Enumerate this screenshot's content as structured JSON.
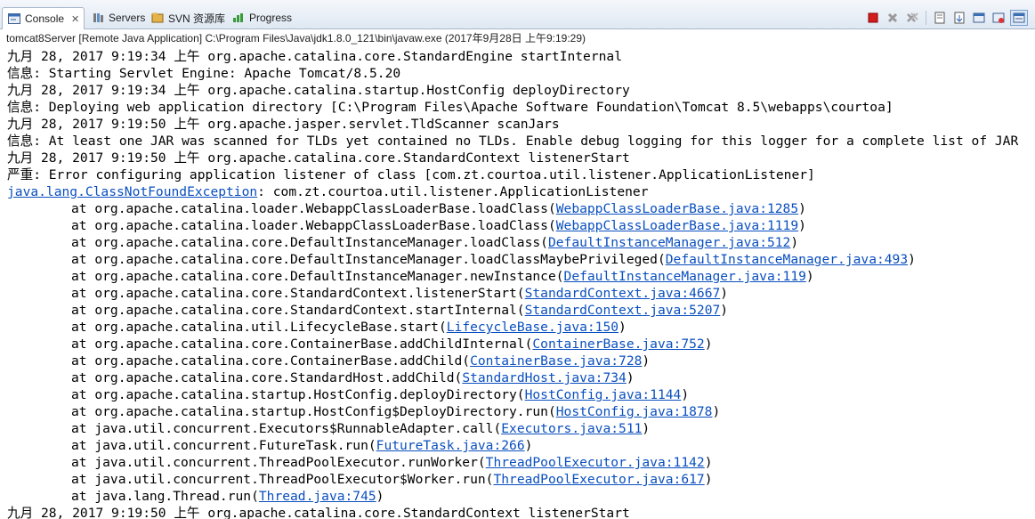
{
  "tabs": [
    {
      "label": "Console",
      "icon": "console-icon",
      "active": true
    },
    {
      "label": "Servers",
      "icon": "servers-icon"
    },
    {
      "label": "SVN 资源库",
      "icon": "svn-icon"
    },
    {
      "label": "Progress",
      "icon": "progress-icon"
    }
  ],
  "toolbar": [
    "terminate-icon",
    "remove-launch-icon",
    "remove-all-icon",
    "clear-console-icon",
    "scroll-lock-icon",
    "show-console-icon",
    "pin-console-icon",
    "display-selected-console-icon"
  ],
  "launch_info": "tomcat8Server [Remote Java Application] C:\\Program Files\\Java\\jdk1.8.0_121\\bin\\javaw.exe (2017年9月28日 上午9:19:29)",
  "log": {
    "l1": "九月 28, 2017 9:19:34 上午 org.apache.catalina.core.StandardEngine startInternal",
    "l2": "信息: Starting Servlet Engine: Apache Tomcat/8.5.20",
    "l3": "九月 28, 2017 9:19:34 上午 org.apache.catalina.startup.HostConfig deployDirectory",
    "l4": "信息: Deploying web application directory [C:\\Program Files\\Apache Software Foundation\\Tomcat 8.5\\webapps\\courtoa]",
    "l5": "九月 28, 2017 9:19:50 上午 org.apache.jasper.servlet.TldScanner scanJars",
    "l6": "信息: At least one JAR was scanned for TLDs yet contained no TLDs. Enable debug logging for this logger for a complete list of JAR",
    "l7": "九月 28, 2017 9:19:50 上午 org.apache.catalina.core.StandardContext listenerStart",
    "l8": "严重: Error configuring application listener of class [com.zt.courtoa.util.listener.ApplicationListener]",
    "exception_link": "java.lang.ClassNotFoundException",
    "exception_msg": ": com.zt.courtoa.util.listener.ApplicationListener",
    "last": "九月 28, 2017 9:19:50 上午 org.apache.catalina.core.StandardContext listenerStart"
  },
  "stack": [
    {
      "text": "at org.apache.catalina.loader.WebappClassLoaderBase.loadClass(",
      "link": "WebappClassLoaderBase.java:1285"
    },
    {
      "text": "at org.apache.catalina.loader.WebappClassLoaderBase.loadClass(",
      "link": "WebappClassLoaderBase.java:1119"
    },
    {
      "text": "at org.apache.catalina.core.DefaultInstanceManager.loadClass(",
      "link": "DefaultInstanceManager.java:512"
    },
    {
      "text": "at org.apache.catalina.core.DefaultInstanceManager.loadClassMaybePrivileged(",
      "link": "DefaultInstanceManager.java:493"
    },
    {
      "text": "at org.apache.catalina.core.DefaultInstanceManager.newInstance(",
      "link": "DefaultInstanceManager.java:119"
    },
    {
      "text": "at org.apache.catalina.core.StandardContext.listenerStart(",
      "link": "StandardContext.java:4667"
    },
    {
      "text": "at org.apache.catalina.core.StandardContext.startInternal(",
      "link": "StandardContext.java:5207"
    },
    {
      "text": "at org.apache.catalina.util.LifecycleBase.start(",
      "link": "LifecycleBase.java:150"
    },
    {
      "text": "at org.apache.catalina.core.ContainerBase.addChildInternal(",
      "link": "ContainerBase.java:752"
    },
    {
      "text": "at org.apache.catalina.core.ContainerBase.addChild(",
      "link": "ContainerBase.java:728"
    },
    {
      "text": "at org.apache.catalina.core.StandardHost.addChild(",
      "link": "StandardHost.java:734"
    },
    {
      "text": "at org.apache.catalina.startup.HostConfig.deployDirectory(",
      "link": "HostConfig.java:1144"
    },
    {
      "text": "at org.apache.catalina.startup.HostConfig$DeployDirectory.run(",
      "link": "HostConfig.java:1878"
    },
    {
      "text": "at java.util.concurrent.Executors$RunnableAdapter.call(",
      "link": "Executors.java:511"
    },
    {
      "text": "at java.util.concurrent.FutureTask.run(",
      "link": "FutureTask.java:266"
    },
    {
      "text": "at java.util.concurrent.ThreadPoolExecutor.runWorker(",
      "link": "ThreadPoolExecutor.java:1142"
    },
    {
      "text": "at java.util.concurrent.ThreadPoolExecutor$Worker.run(",
      "link": "ThreadPoolExecutor.java:617"
    },
    {
      "text": "at java.lang.Thread.run(",
      "link": "Thread.java:745"
    }
  ]
}
